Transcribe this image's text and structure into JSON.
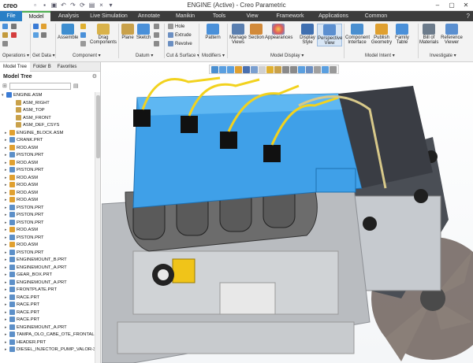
{
  "app": {
    "logo": "creo",
    "window_title": "ENGINE (Active) - Creo Parametric"
  },
  "tabs": [
    "File",
    "Model",
    "Analysis",
    "Live Simulation",
    "Annotate",
    "Manikin",
    "Tools",
    "View",
    "Framework",
    "Applications",
    "Common"
  ],
  "ribbon": {
    "buttons": {
      "assemble": "Assemble",
      "drag_components": "Drag Components",
      "plane": "Plane",
      "sketch": "Sketch",
      "hole": "Hole",
      "extrude": "Extrude",
      "revolve": "Revolve",
      "pattern": "Pattern",
      "manage_views": "Manage Views",
      "section": "Section",
      "appearances": "Appearances",
      "display_style": "Display Style",
      "perspective_view": "Perspective View",
      "component_interface": "Component Interface",
      "publish_geometry": "Publish Geometry",
      "family_table": "Family Table",
      "bill_of_materials": "Bill of Materials",
      "reference_viewer": "Reference Viewer"
    },
    "groups": {
      "operations": "Operations ▾",
      "get_data": "Get Data ▾",
      "component": "Component ▾",
      "datum": "Datum ▾",
      "cut_surface": "Cut & Surface ▾",
      "modifiers": "Modifiers ▾",
      "model_display": "Model Display ▾",
      "model_intent": "Model Intent ▾",
      "investigate": "Investigate ▾"
    }
  },
  "panel": {
    "tabs": [
      "Model Tree",
      "Folder B",
      "Favorites"
    ],
    "header": "Model Tree",
    "tree": [
      "ENGINE.ASM",
      "ASM_RIGHT",
      "ASM_TOP",
      "ASM_FRONT",
      "ASM_DEF_CSYS",
      "ENGINE_BLOCK.ASM",
      "CRANK.PRT",
      "ROD.ASM",
      "PISTON.PRT",
      "ROD.ASM",
      "PISTON.PRT",
      "ROD.ASM",
      "ROD.ASM",
      "ROD.ASM",
      "ROD.ASM",
      "PISTON.PRT",
      "PISTON.PRT",
      "PISTON.PRT",
      "ROD.ASM",
      "PISTON.PRT",
      "ROD.ASM",
      "PISTON.PRT",
      "ENGINEMOUNT_B.PRT",
      "ENGINEMOUNT_A.PRT",
      "GEAR_BOX.PRT",
      "ENGINEMOUNT_A.PRT",
      "FRONTPLATE.PRT",
      "RACE.PRT",
      "RACE.PRT",
      "RACE.PRT",
      "RACE.PRT",
      "ENGINEMOUNT_A.PRT",
      "TAMPA_OLO_CABE_OTE_FRONTAL.PRT",
      "HEADER.PRT",
      "DIESEL_INJECTOR_PUMP_VALOR-35250"
    ]
  }
}
